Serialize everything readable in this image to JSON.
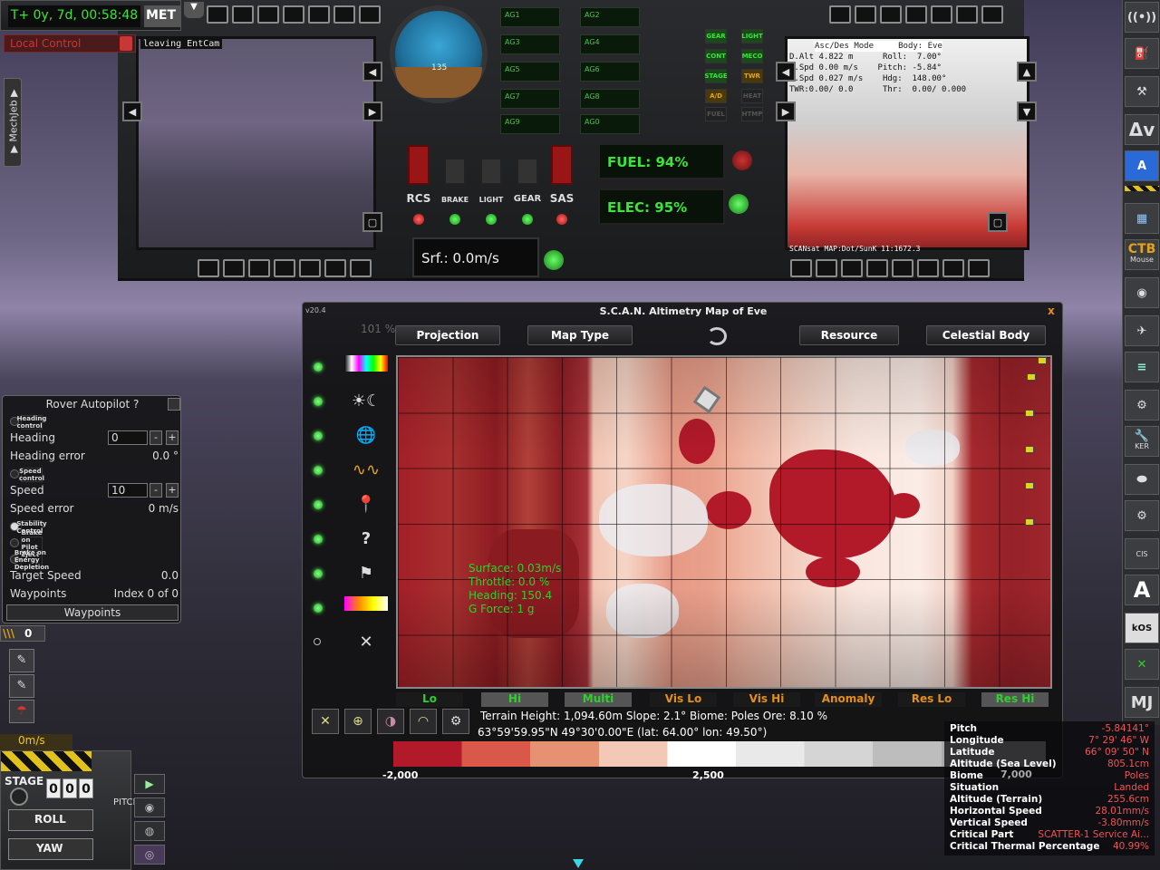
{
  "met": {
    "time": "T+ 0y, 7d, 00:58:48",
    "label": "MET"
  },
  "local_control": "Local Control",
  "mechjeb_tab": "▶ MechJeb ▶",
  "cockpit": {
    "left_mfd_label": "leaving EntCam",
    "action_groups": [
      "AG1",
      "AG2",
      "AG3",
      "AG4",
      "AG5",
      "AG6",
      "AG7",
      "AG8",
      "AG9",
      "AG0"
    ],
    "indicators": [
      "GEAR",
      "LIGHT",
      "CONT",
      "MECO",
      "STAGE",
      "TWR",
      "A/D",
      "HEAT",
      "FUEL",
      "HTMP"
    ],
    "toggles": [
      "RCS",
      "BRAKE",
      "LIGHT",
      "GEAR",
      "SAS"
    ],
    "fuel": "FUEL:  94%",
    "elec": "ELEC:  95%",
    "srf": "Srf.: 0.0m/s",
    "navball_num": "135",
    "right_mfd_head": "Asc/Des Mode     Body: Eve",
    "right_mfd_stats": "D.Alt 4.822 m      Roll:  7.00°\nH.Spd 0.00 m/s    Pitch: -5.84°\nV.Spd 0.027 m/s    Hdg:  148.00°\nTWR:0.00/ 0.0      Thr:  0.00/ 0.000",
    "right_mfd_foot": "SCANsat MAP:Dot/SunK 11:1672.3"
  },
  "toolbar": {
    "buttons": [
      "((•))",
      "⛽",
      "⚒",
      "Δv",
      "A",
      "",
      "CTB",
      "",
      "",
      "",
      "",
      "KER",
      "",
      "",
      "CIS",
      "A",
      "kOS",
      "",
      "MJ"
    ],
    "ctb_sub": "Mouse",
    "cis_sub": "CIS",
    "ker_sub": "KER"
  },
  "scan": {
    "version": "v20.4",
    "title": "S.C.A.N. Altimetry Map of Eve",
    "close": "x",
    "zoom": "101 %",
    "projection": "Projection",
    "map_type": "Map Type",
    "resource": "Resource",
    "celestial_body": "Celestial Body",
    "overlay": {
      "surface": "Surface: 0.03m/s",
      "throttle": "Throttle: 0.0 %",
      "heading": "Heading: 150.4",
      "gforce": "G Force: 1 g"
    },
    "legend_tabs": [
      {
        "label": "Lo",
        "color": "#2ed02e"
      },
      {
        "label": "Hi",
        "color": "#2ed02e"
      },
      {
        "label": "Multi",
        "color": "#2ed02e"
      },
      {
        "label": "Vis Lo",
        "color": "#e38f1a"
      },
      {
        "label": "Vis Hi",
        "color": "#e38f1a"
      },
      {
        "label": "Anomaly",
        "color": "#e38f1a"
      },
      {
        "label": "Res Lo",
        "color": "#e38f1a"
      },
      {
        "label": "Res Hi",
        "color": "#2ed02e"
      }
    ],
    "terrain_info": "Terrain Height: 1,094.60m Slope: 2.1° Biome: Poles Ore: 8.10 %",
    "coord_info": "63°59'59.95\"N 49°30'0.00\"E (lat: 64.00° lon: 49.50°)",
    "gradient_min": "-2,000",
    "gradient_mid": "2,500",
    "gradient_max": "7,000"
  },
  "rover": {
    "title": "Rover Autopilot  ?",
    "heading_control": "Heading control",
    "heading": "Heading",
    "heading_value": "0",
    "heading_error": "Heading error",
    "heading_error_value": "0.0 °",
    "speed_control": "Speed control",
    "speed": "Speed",
    "speed_value": "10",
    "speed_error": "Speed error",
    "speed_error_value": "0 m/s",
    "stability": "Stability Control",
    "brake_eject": "Brake on Pilot Eject",
    "brake_energy": "Brake on Energy Depletion",
    "target_speed": "Target Speed",
    "target_speed_value": "0.0",
    "waypoints": "Waypoints",
    "waypoints_index": "Index 0 of 0",
    "waypoints_button": "Waypoints",
    "minus": "-",
    "plus": "+"
  },
  "warp": {
    "chevrons": "\\\\\\",
    "value": "0"
  },
  "speed_display": "0m/s",
  "staging": {
    "stage": "STAGE",
    "digits": [
      "0",
      "0",
      "0"
    ],
    "roll": "ROLL",
    "yaw": "YAW",
    "pitch": "PITCH"
  },
  "info_panel": [
    {
      "k": "Pitch",
      "v": "-5.84141°"
    },
    {
      "k": "Longitude",
      "v": "7° 29' 46\" W"
    },
    {
      "k": "Latitude",
      "v": "66° 09' 50\" N"
    },
    {
      "k": "Altitude (Sea Level)",
      "v": "805.1cm"
    },
    {
      "k": "Biome",
      "v": "Poles"
    },
    {
      "k": "Situation",
      "v": "Landed"
    },
    {
      "k": "Altitude (Terrain)",
      "v": "255.6cm"
    },
    {
      "k": "Horizontal Speed",
      "v": "28.01mm/s"
    },
    {
      "k": "Vertical Speed",
      "v": "-3.80mm/s"
    },
    {
      "k": "Critical Part",
      "v": "SCATTER-1 Service Ai..."
    },
    {
      "k": "Critical Thermal Percentage",
      "v": "40.99%"
    }
  ],
  "colors": {
    "accent_green": "#3be33b",
    "accent_orange": "#e38f1a",
    "warning_red": "#c83636",
    "info_value_red": "#e55555"
  }
}
